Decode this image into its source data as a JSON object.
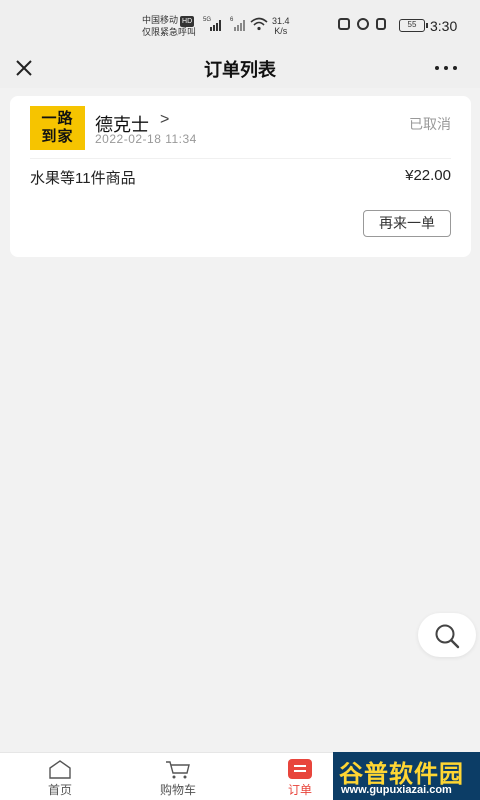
{
  "status_bar": {
    "carrier_line1": "中国移动",
    "hd_badge": "HD",
    "carrier_line2": "仅限紧急呼叫",
    "network_5g": "5G",
    "network_6": "6",
    "speed_value": "31.4",
    "speed_unit": "K/s",
    "battery": "55",
    "time": "3:30"
  },
  "nav": {
    "title": "订单列表",
    "close_icon": "close-icon",
    "more_icon": "more-icon"
  },
  "order": {
    "logo_line1": "一路",
    "logo_line2": "到家",
    "store_name": "德克士",
    "store_arrow": ">",
    "time": "2022-02-18 11:34",
    "status": "已取消",
    "goods_summary": "水果等11件商品",
    "price": "¥22.00",
    "reorder_label": "再来一单"
  },
  "float_search_icon": "search-icon",
  "tabs": [
    {
      "label": "首页",
      "icon": "home-icon"
    },
    {
      "label": "购物车",
      "icon": "cart-icon"
    },
    {
      "label": "订单",
      "icon": "order-icon"
    }
  ],
  "active_tab": "订单",
  "colors": {
    "accent": "#e8453c",
    "logo_yellow": "#f6c400",
    "background": "#f2f2f2"
  },
  "watermark": {
    "main": "谷普软件园",
    "sub": "www.gupuxiazai.com"
  }
}
